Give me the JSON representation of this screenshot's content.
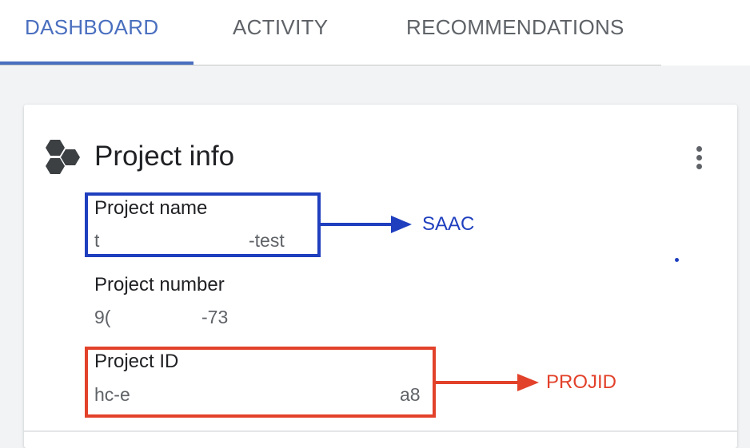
{
  "tabs": [
    {
      "label": "DASHBOARD",
      "active": true
    },
    {
      "label": "ACTIVITY",
      "active": false
    },
    {
      "label": "RECOMMENDATIONS",
      "active": false
    }
  ],
  "card": {
    "title": "Project info",
    "icon": "hexagons-icon",
    "menu_icon": "more-vert-icon",
    "fields": {
      "project_name": {
        "label": "Project name",
        "value_start": "t",
        "value_end": "-test"
      },
      "project_number": {
        "label": "Project number",
        "value_start": "9(",
        "value_end": "-73"
      },
      "project_id": {
        "label": "Project ID",
        "value_start": "hc-e",
        "value_end": "a8"
      }
    }
  },
  "annotations": {
    "name_tag": {
      "text": "SAAC",
      "color": "#1f3fbf"
    },
    "id_tag": {
      "text": "PROJID",
      "color": "#e2412a"
    }
  },
  "colors": {
    "accent": "#4a6fbf",
    "tab_inactive": "#5f6368",
    "annotation_blue": "#1f3fbf",
    "annotation_red": "#e2412a"
  }
}
